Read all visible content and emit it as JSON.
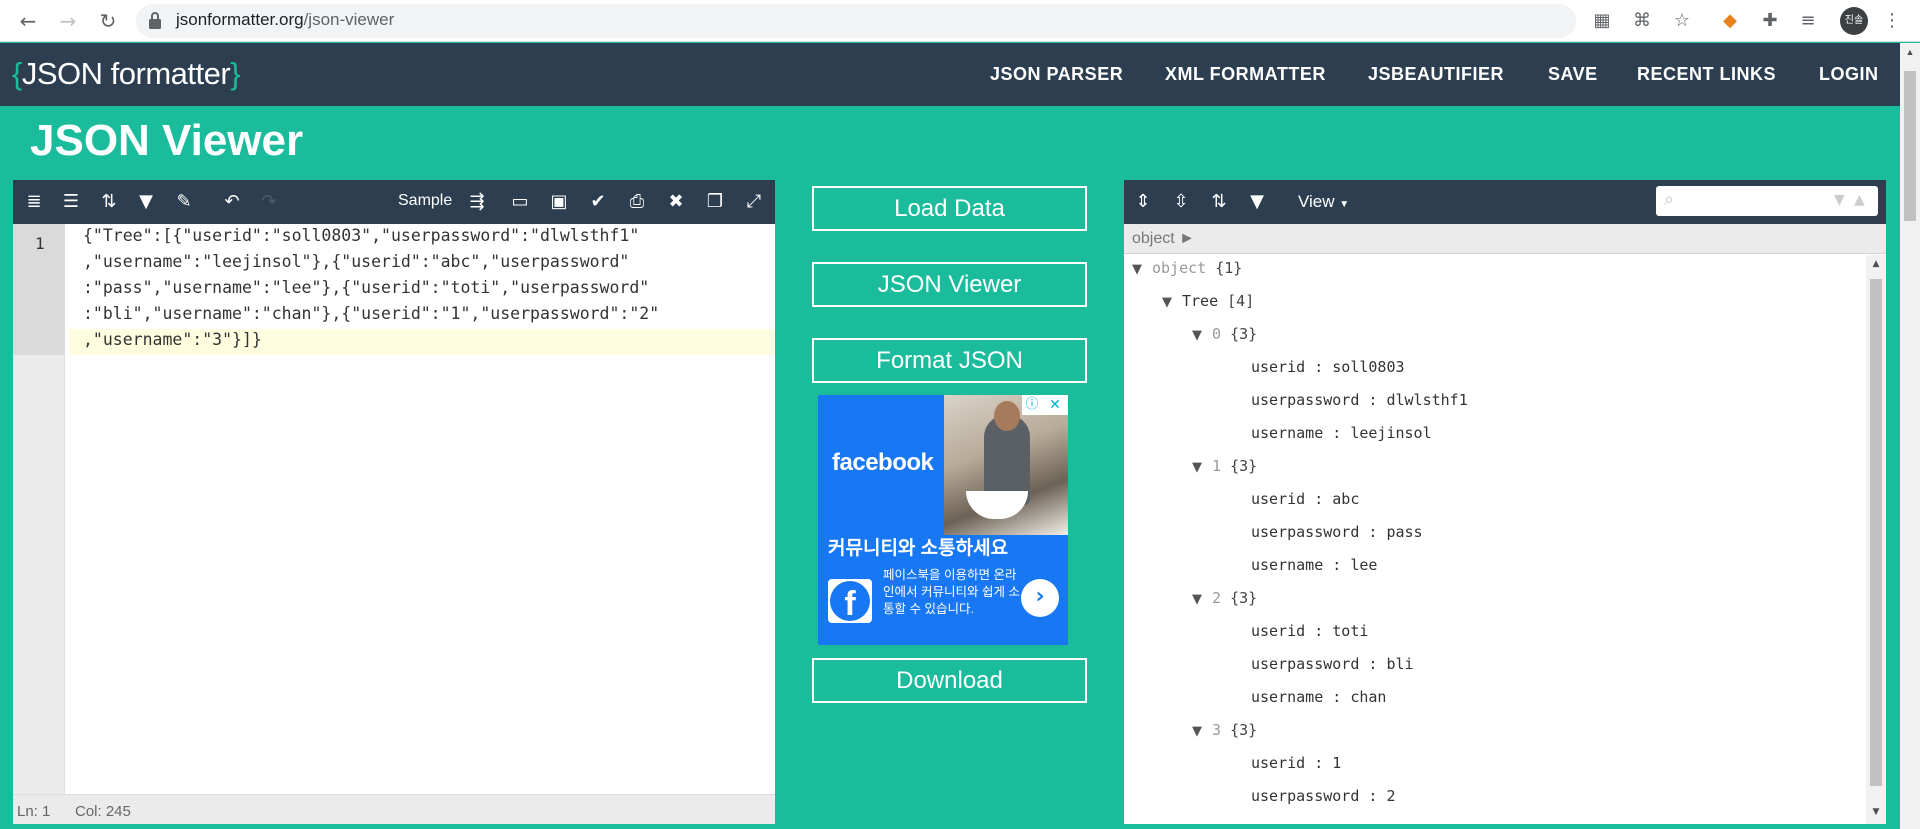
{
  "browser": {
    "url_host": "jsonformatter.org",
    "url_path": "/json-viewer",
    "avatar_text": "진솔"
  },
  "site": {
    "logo_open": "{",
    "logo_text": "JSON formatter",
    "logo_close": "}",
    "nav": [
      "JSON PARSER",
      "XML FORMATTER",
      "JSBEAUTIFIER",
      "SAVE",
      "RECENT LINKS",
      "LOGIN"
    ],
    "page_title": "JSON Viewer"
  },
  "editor": {
    "sample_label": "Sample",
    "line_number": "1",
    "code_lines": [
      "{\"Tree\":[{\"userid\":\"soll0803\",\"userpassword\":\"dlwlsthf1\"",
      ",\"username\":\"leejinsol\"},{\"userid\":\"abc\",\"userpassword\"",
      ":\"pass\",\"username\":\"lee\"},{\"userid\":\"toti\",\"userpassword\"",
      ":\"bli\",\"username\":\"chan\"},{\"userid\":\"1\",\"userpassword\":\"2\"",
      ",\"username\":\"3\"}]}"
    ],
    "status_ln": "Ln: 1",
    "status_col": "Col: 245"
  },
  "actions": {
    "load_data": "Load Data",
    "json_viewer": "JSON Viewer",
    "format_json": "Format JSON",
    "download": "Download"
  },
  "ad": {
    "brand": "facebook",
    "title": "커뮤니티와 소통하세요",
    "desc": "페이스북을 이용하면 온라인에서 커뮤니티와 쉽게 소통할 수 있습니다.",
    "logo_letter": "f"
  },
  "viewer": {
    "view_label": "View",
    "breadcrumb": "object ►",
    "tree": [
      {
        "indent": 0,
        "key": "object",
        "meta": "{1}",
        "toggle": true,
        "dimkey": true
      },
      {
        "indent": 1,
        "key": "Tree",
        "meta": "[4]",
        "toggle": true
      },
      {
        "indent": 2,
        "key": "0",
        "meta": "{3}",
        "toggle": true,
        "dimkey": true
      },
      {
        "indent": 3,
        "key": "userid",
        "value": "soll0803"
      },
      {
        "indent": 3,
        "key": "userpassword",
        "value": "dlwlsthf1"
      },
      {
        "indent": 3,
        "key": "username",
        "value": "leejinsol"
      },
      {
        "indent": 2,
        "key": "1",
        "meta": "{3}",
        "toggle": true,
        "dimkey": true
      },
      {
        "indent": 3,
        "key": "userid",
        "value": "abc"
      },
      {
        "indent": 3,
        "key": "userpassword",
        "value": "pass"
      },
      {
        "indent": 3,
        "key": "username",
        "value": "lee"
      },
      {
        "indent": 2,
        "key": "2",
        "meta": "{3}",
        "toggle": true,
        "dimkey": true
      },
      {
        "indent": 3,
        "key": "userid",
        "value": "toti"
      },
      {
        "indent": 3,
        "key": "userpassword",
        "value": "bli"
      },
      {
        "indent": 3,
        "key": "username",
        "value": "chan"
      },
      {
        "indent": 2,
        "key": "3",
        "meta": "{3}",
        "toggle": true,
        "dimkey": true
      },
      {
        "indent": 3,
        "key": "userid",
        "value": "1"
      },
      {
        "indent": 3,
        "key": "userpassword",
        "value": "2"
      }
    ]
  }
}
